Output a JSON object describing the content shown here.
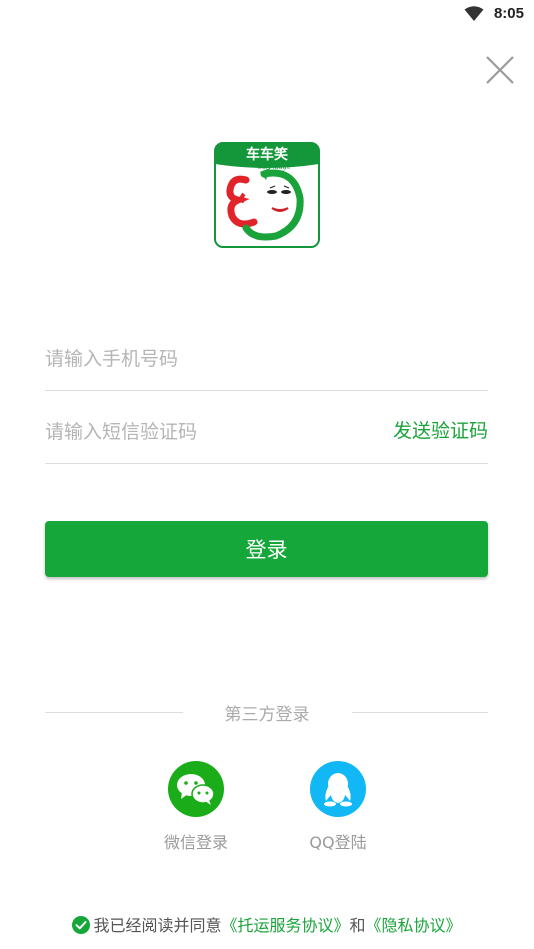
{
  "status_bar": {
    "time": "8:05",
    "wifi_icon": "wifi-icon"
  },
  "close_icon": "close-icon",
  "logo": {
    "text": "车车笑",
    "subtext": "Cart laugh"
  },
  "phone_field": {
    "placeholder": "请输入手机号码",
    "value": ""
  },
  "code_field": {
    "placeholder": "请输入短信验证码",
    "value": ""
  },
  "send_code_label": "发送验证码",
  "login_label": "登录",
  "third_party": {
    "title": "第三方登录",
    "wechat_label": "微信登录",
    "qq_label": "QQ登陆"
  },
  "agreement": {
    "prefix": "我已经阅读并同意",
    "terms_link": "《托运服务协议》",
    "and": "和",
    "privacy_link": "《隐私协议》"
  },
  "colors": {
    "accent": "#16a73a",
    "wechat": "#1aad19",
    "qq": "#12b7f5"
  }
}
